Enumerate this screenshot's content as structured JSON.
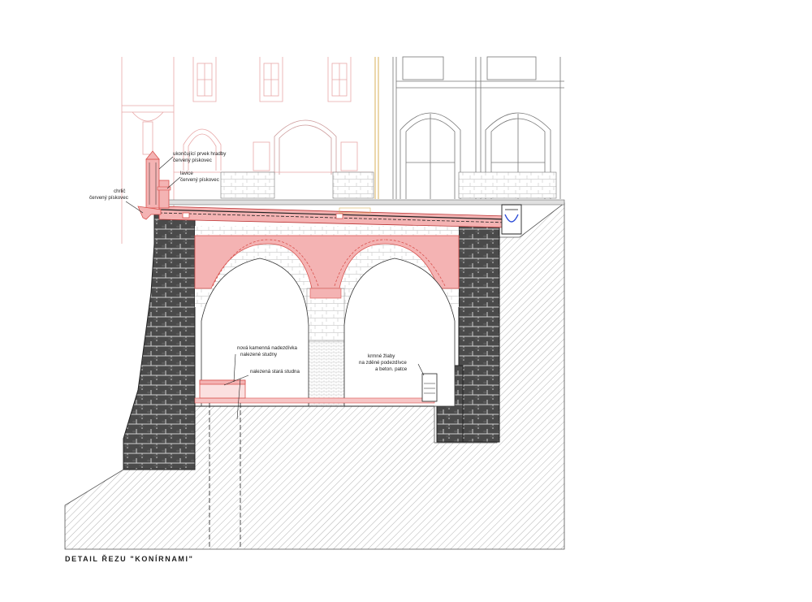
{
  "title": "DETAIL ŘEZU \"KONÍRNAMI\"",
  "labels": {
    "coping_line1": "ukončující prvek hradby",
    "coping_line2": "červený pískovec",
    "bench_line1": "lavice",
    "bench_line2": "červený pískovec",
    "spout_line1": "chrlič",
    "spout_line2": "červený pískovec",
    "well_curb_line1": "nová kamenná nadezdívka",
    "well_curb_line2": "nalezené studny",
    "old_well": "nalezená stará studna",
    "troughs_line1": "krmné žlaby",
    "troughs_line2": "na zděné podezdívce",
    "troughs_line3": "a beton. patce"
  },
  "colors": {
    "sandstone": "#f4b3b3",
    "sandstone_line": "#d9534f",
    "facade_line": "#e8a8a8",
    "masonry_dark": "#3e3e3e",
    "masonry_light": "#dcdcdc",
    "ground_hatch": "#9a9a9a"
  }
}
